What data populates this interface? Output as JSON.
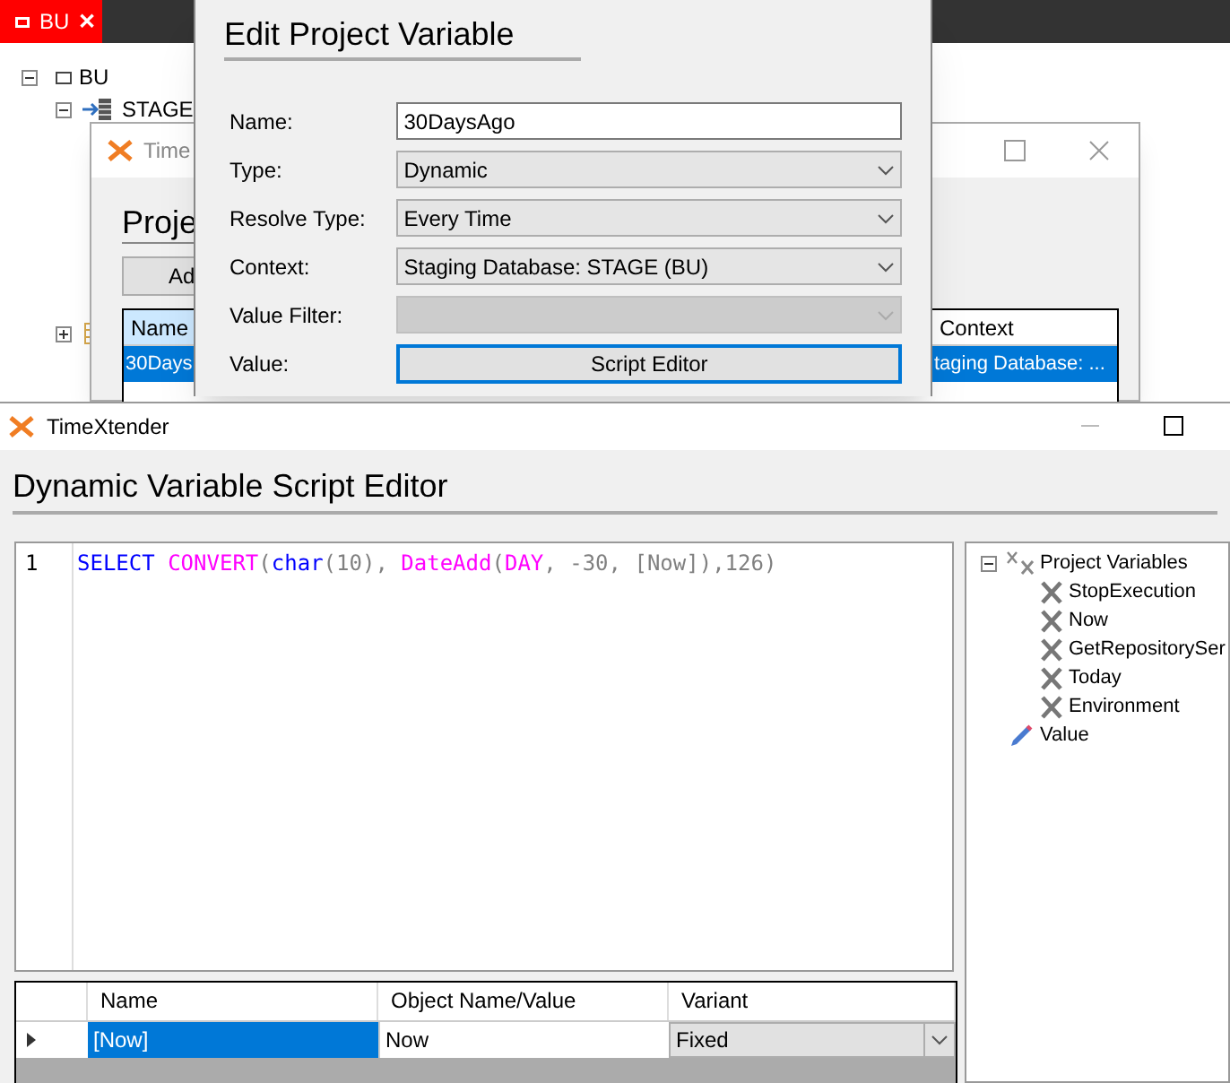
{
  "background_app": {
    "tab": {
      "label": "BU",
      "close": "✕"
    },
    "tree": [
      {
        "label": "BU",
        "expanded": true,
        "children": [
          {
            "label": "STAGE",
            "expanded": true
          },
          {
            "expanded": false
          }
        ]
      }
    ]
  },
  "project_window": {
    "title": "Time",
    "heading": "Proje",
    "button": "Ad",
    "grid": {
      "columns": [
        "Name",
        "Context"
      ],
      "rows": [
        {
          "cells": [
            "30Days",
            "taging Database: ..."
          ],
          "selected": true
        }
      ]
    }
  },
  "edit_dialog": {
    "title": "Edit Project Variable",
    "fields": [
      {
        "kind": "text",
        "label": "Name:",
        "value": "30DaysAgo"
      },
      {
        "kind": "dropdown",
        "label": "Type:",
        "value": "Dynamic",
        "disabled": false
      },
      {
        "kind": "dropdown",
        "label": "Resolve Type:",
        "value": "Every Time",
        "disabled": false
      },
      {
        "kind": "dropdown",
        "label": "Context:",
        "value": "Staging Database: STAGE (BU)",
        "disabled": false
      },
      {
        "kind": "dropdown",
        "label": "Value Filter:",
        "disabled": true
      },
      {
        "kind": "button",
        "label": "Value:",
        "value": "Script Editor"
      }
    ]
  },
  "editor_window": {
    "title": "TimeXtender",
    "heading": "Dynamic Variable Script Editor",
    "code_lines": [
      {
        "number": "1",
        "tokens": [
          {
            "kind": "keyword",
            "text": "SELECT "
          },
          {
            "kind": "function",
            "text": "CONVERT"
          },
          {
            "kind": "plain",
            "text": "("
          },
          {
            "kind": "keyword",
            "text": "char"
          },
          {
            "kind": "plain",
            "text": "(10), "
          },
          {
            "kind": "function",
            "text": "DateAdd"
          },
          {
            "kind": "plain",
            "text": "("
          },
          {
            "kind": "function",
            "text": "DAY"
          },
          {
            "kind": "plain",
            "text": ", -30, [Now]),126)"
          }
        ]
      }
    ],
    "tree": [
      {
        "label": "Project Variables",
        "kind": "group",
        "expanded": true,
        "children": [
          {
            "label": "StopExecution",
            "kind": "variable"
          },
          {
            "label": "Now",
            "kind": "variable"
          },
          {
            "label": "GetRepositorySer",
            "kind": "variable"
          },
          {
            "label": "Today",
            "kind": "variable"
          },
          {
            "label": "Environment",
            "kind": "variable"
          }
        ]
      },
      {
        "label": "Value",
        "kind": "value"
      }
    ],
    "grid": {
      "columns": [
        "Name",
        "Object Name/Value",
        "Variant"
      ],
      "rows": [
        {
          "current": true,
          "name": "[Now]",
          "object": "Now",
          "variant": "Fixed",
          "selected": true
        }
      ]
    }
  }
}
